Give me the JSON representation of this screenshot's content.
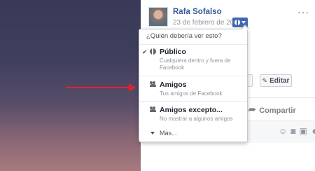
{
  "post": {
    "author": "Rafa Sofalso",
    "date": "23 de febrero de 2015",
    "edit_label": "Editar",
    "share_label": "Compartir"
  },
  "privacy_menu": {
    "header": "¿Quién debería ver esto?",
    "options": [
      {
        "title": "Público",
        "description": "Cualquiera dentro y fuera de Facebook",
        "icon": "globe-icon",
        "selected": true
      },
      {
        "title": "Amigos",
        "description": "Tus amigos de Facebook",
        "icon": "people-icon",
        "selected": false
      },
      {
        "title": "Amigos excepto...",
        "description": "No mostrar a algunos amigos",
        "icon": "people-icon",
        "selected": false
      }
    ],
    "more_label": "Más..."
  },
  "icons": {
    "privacy_button": "globe-icon",
    "post_menu": "more-options-icon",
    "comment_tools": [
      "emoji-icon",
      "camera-icon",
      "gif-icon",
      "sticker-icon"
    ]
  },
  "colors": {
    "facebook_blue": "#4267b2",
    "link_blue": "#365899",
    "annotation_arrow": "#e3222a"
  }
}
